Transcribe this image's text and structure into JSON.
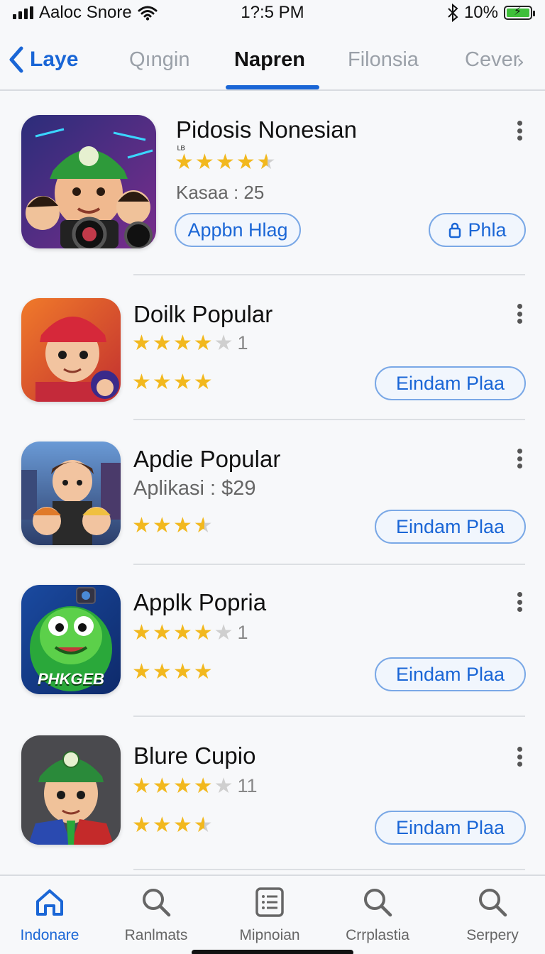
{
  "status_bar": {
    "carrier": "Aaloc Snore",
    "time": "1?:5 PM",
    "battery": "10%",
    "icons": [
      "signal-icon",
      "wifi-icon",
      "bluetooth-icon",
      "battery-icon"
    ]
  },
  "nav": {
    "back_label": "Laye",
    "tabs": [
      {
        "label": "Qıngin",
        "active": false
      },
      {
        "label": "Napren",
        "active": true
      },
      {
        "label": "Filonsia",
        "active": false
      },
      {
        "label": "Cever",
        "active": false
      }
    ],
    "accent": "#1a66d6"
  },
  "apps": [
    {
      "title": "Pidosis Nonesian",
      "tiny_label": "ᴸᴮ",
      "rating": 4.5,
      "meta": "Kasaa : 25",
      "buttons": [
        {
          "label": "Appbn Hlag",
          "icon": ""
        },
        {
          "label": "Phla",
          "icon": "lock-icon"
        }
      ]
    },
    {
      "title": "Doilk Popular",
      "rating": 4,
      "count": "1",
      "rating2": 4,
      "button": "Eindam Plaa"
    },
    {
      "title": "Apdie Popular",
      "meta": "Aplikasi : $29",
      "rating": 3.5,
      "button": "Eindam Plaa"
    },
    {
      "title": "Applk Popria",
      "rating": 4,
      "count": "1",
      "rating2": 4,
      "button": "Eindam Plaa",
      "icon_text": "PHKGEB"
    },
    {
      "title": "Blure Cupio",
      "rating": 4,
      "count": "11",
      "rating2": 3.5,
      "button": "Eindam Plaa"
    }
  ],
  "bottom_tabs": [
    {
      "label": "Indonare",
      "icon": "home-icon",
      "active": true
    },
    {
      "label": "Ranlmats",
      "icon": "search-icon",
      "active": false
    },
    {
      "label": "Mipnoian",
      "icon": "list-icon",
      "active": false
    },
    {
      "label": "Crrplastia",
      "icon": "search-icon",
      "active": false
    },
    {
      "label": "Serpery",
      "icon": "search-icon",
      "active": false
    }
  ]
}
